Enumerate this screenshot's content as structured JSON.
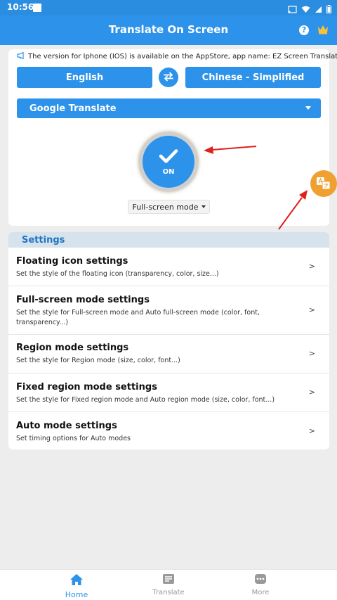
{
  "status": {
    "time": "10:56"
  },
  "appbar": {
    "title": "Translate On Screen",
    "help_label": "?"
  },
  "notice": {
    "text": "The version for Iphone (IOS) is available on the AppStore, app name: EZ Screen Translator"
  },
  "languages": {
    "source": "English",
    "target": "Chinese - Simplified"
  },
  "engine": {
    "selected": "Google Translate"
  },
  "power": {
    "label": "ON"
  },
  "mode": {
    "selected": "Full-screen mode"
  },
  "settings": {
    "header": "Settings",
    "items": [
      {
        "title": "Floating icon settings",
        "desc": "Set the style of the floating icon (transparency, color, size...)"
      },
      {
        "title": "Full-screen mode settings",
        "desc": "Set the style for Full-screen mode and Auto full-screen mode (color, font, transparency...)"
      },
      {
        "title": "Region mode settings",
        "desc": "Set the style for Region mode (size, color, font...)"
      },
      {
        "title": "Fixed region mode settings",
        "desc": "Set the style for Fixed region mode and Auto region mode (size, color, font...)"
      },
      {
        "title": "Auto mode settings",
        "desc": "Set timing options for Auto modes"
      }
    ],
    "chevron": ">"
  },
  "nav": {
    "home": "Home",
    "translate": "Translate",
    "more": "More"
  },
  "colors": {
    "primary": "#2d92ea",
    "header_bg": "#d6e2ec",
    "float_icon": "#f0a030",
    "annotation_arrow": "#e0201a"
  }
}
